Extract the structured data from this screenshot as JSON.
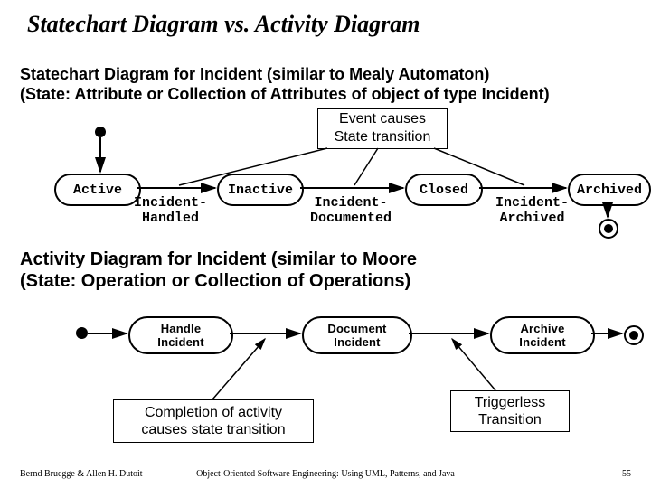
{
  "title": "Statechart Diagram vs. Activity Diagram",
  "subtitle1": "Statechart Diagram for Incident (similar to Mealy Automaton)",
  "subtitle2": "(State: Attribute or Collection of Attributes of object of type Incident)",
  "event_box_l1": "Event causes",
  "event_box_l2": "State transition",
  "statechart": {
    "states": {
      "active": "Active",
      "inactive": "Inactive",
      "closed": "Closed",
      "archived": "Archived"
    },
    "transitions": {
      "t1_l1": "Incident-",
      "t1_l2": "Handled",
      "t2_l1": "Incident-",
      "t2_l2": "Documented",
      "t3_l1": "Incident-",
      "t3_l2": "Archived"
    }
  },
  "activity_header_l1": "Activity Diagram for Incident (similar to Moore",
  "activity_header_l2": "(State: Operation or Collection of Operations)",
  "activities": {
    "a1_l1": "Handle",
    "a1_l2": "Incident",
    "a2_l1": "Document",
    "a2_l2": "Incident",
    "a3_l1": "Archive",
    "a3_l2": "Incident"
  },
  "caption_left_l1": "Completion of activity",
  "caption_left_l2": "causes state transition",
  "caption_right_l1": "Triggerless",
  "caption_right_l2": "Transition",
  "footer": {
    "left": "Bernd Bruegge & Allen H. Dutoit",
    "center": "Object-Oriented Software Engineering: Using UML, Patterns, and Java",
    "right": "55"
  }
}
